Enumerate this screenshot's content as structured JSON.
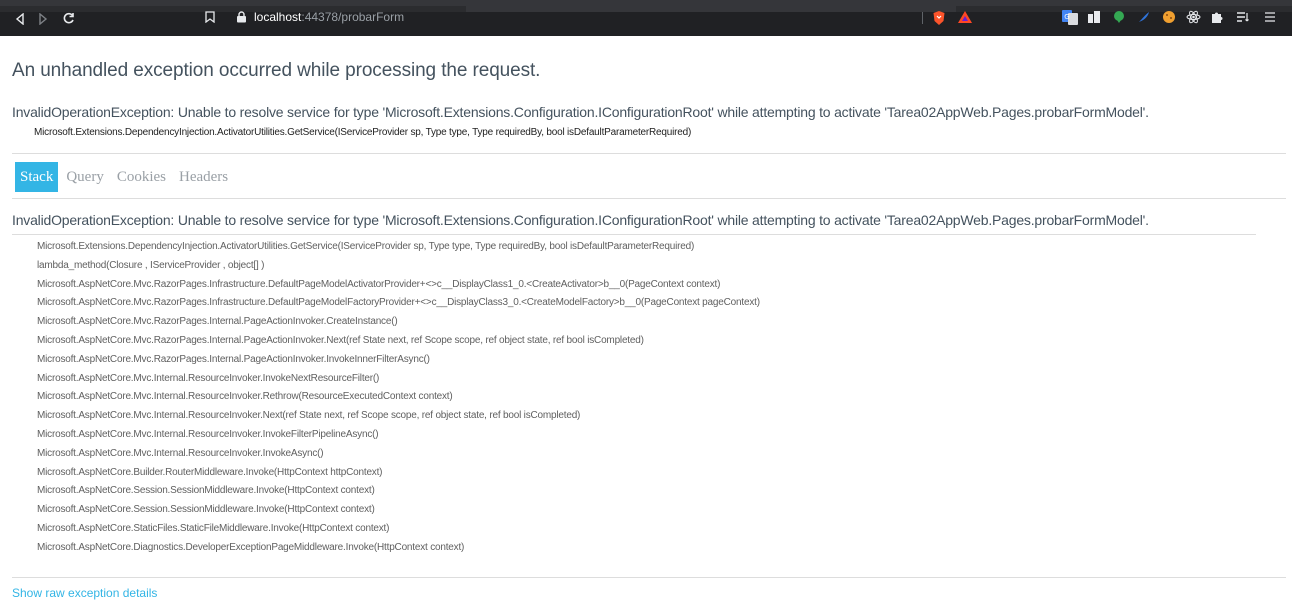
{
  "browser": {
    "url_host": "localhost",
    "url_rest": ":44378/probarForm",
    "nav": {
      "back": "◁",
      "forward": "▷",
      "reload": "C"
    },
    "menu_icon": "☰",
    "colors": {
      "chrome_bg": "#202124",
      "brave_orange": "#fb542b",
      "rewards_red": "#ff4724"
    }
  },
  "page": {
    "title": "An unhandled exception occurred while processing the request.",
    "exception": {
      "title": "InvalidOperationException: Unable to resolve service for type 'Microsoft.Extensions.Configuration.IConfigurationRoot' while attempting to activate 'Tarea02AppWeb.Pages.probarFormModel'.",
      "location": "Microsoft.Extensions.DependencyInjection.ActivatorUtilities.GetService(IServiceProvider sp, Type type, Type requiredBy, bool isDefaultParameterRequired)"
    },
    "tabs": [
      {
        "label": "Stack",
        "selected": true
      },
      {
        "label": "Query",
        "selected": false
      },
      {
        "label": "Cookies",
        "selected": false
      },
      {
        "label": "Headers",
        "selected": false
      }
    ],
    "stack": {
      "title": "InvalidOperationException: Unable to resolve service for type 'Microsoft.Extensions.Configuration.IConfigurationRoot' while attempting to activate 'Tarea02AppWeb.Pages.probarFormModel'.",
      "frames": [
        "Microsoft.Extensions.DependencyInjection.ActivatorUtilities.GetService(IServiceProvider sp, Type type, Type requiredBy, bool isDefaultParameterRequired)",
        "lambda_method(Closure , IServiceProvider , object[] )",
        "Microsoft.AspNetCore.Mvc.RazorPages.Infrastructure.DefaultPageModelActivatorProvider+<>c__DisplayClass1_0.<CreateActivator>b__0(PageContext context)",
        "Microsoft.AspNetCore.Mvc.RazorPages.Infrastructure.DefaultPageModelFactoryProvider+<>c__DisplayClass3_0.<CreateModelFactory>b__0(PageContext pageContext)",
        "Microsoft.AspNetCore.Mvc.RazorPages.Internal.PageActionInvoker.CreateInstance()",
        "Microsoft.AspNetCore.Mvc.RazorPages.Internal.PageActionInvoker.Next(ref State next, ref Scope scope, ref object state, ref bool isCompleted)",
        "Microsoft.AspNetCore.Mvc.RazorPages.Internal.PageActionInvoker.InvokeInnerFilterAsync()",
        "Microsoft.AspNetCore.Mvc.Internal.ResourceInvoker.InvokeNextResourceFilter()",
        "Microsoft.AspNetCore.Mvc.Internal.ResourceInvoker.Rethrow(ResourceExecutedContext context)",
        "Microsoft.AspNetCore.Mvc.Internal.ResourceInvoker.Next(ref State next, ref Scope scope, ref object state, ref bool isCompleted)",
        "Microsoft.AspNetCore.Mvc.Internal.ResourceInvoker.InvokeFilterPipelineAsync()",
        "Microsoft.AspNetCore.Mvc.Internal.ResourceInvoker.InvokeAsync()",
        "Microsoft.AspNetCore.Builder.RouterMiddleware.Invoke(HttpContext httpContext)",
        "Microsoft.AspNetCore.Session.SessionMiddleware.Invoke(HttpContext context)",
        "Microsoft.AspNetCore.Session.SessionMiddleware.Invoke(HttpContext context)",
        "Microsoft.AspNetCore.StaticFiles.StaticFileMiddleware.Invoke(HttpContext context)",
        "Microsoft.AspNetCore.Diagnostics.DeveloperExceptionPageMiddleware.Invoke(HttpContext context)"
      ]
    },
    "raw_link_label": "Show raw exception details",
    "colors": {
      "accent": "#33b5e5",
      "heading": "#44525e",
      "frame_text": "#606060"
    }
  }
}
